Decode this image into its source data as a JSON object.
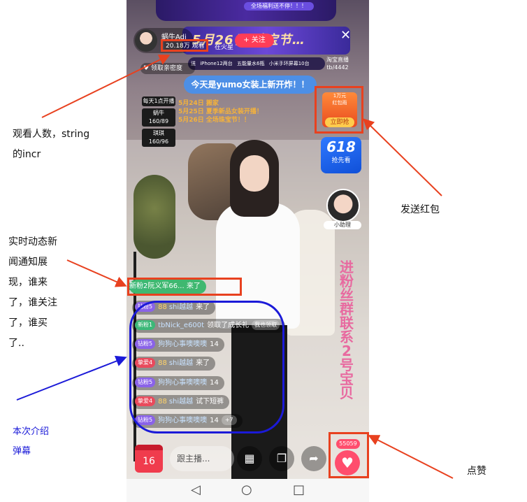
{
  "phone": {
    "top_banner_text": "全场福利送不停！！！",
    "event_banner": "5月26日 珠宝节…",
    "host_name": "蜗牛Adi",
    "viewers": "20.18万 观看",
    "region": "在火星",
    "follow_label": "+ 关注",
    "close_icon": "✕",
    "taobao_badge": "淘宝直播",
    "taobao_sub": "tb/4442",
    "intimacy_label": "领取亲密度",
    "promo_items": [
      "iPhone12两台",
      "五能量水6瓶",
      "小米手环屏幕10台"
    ],
    "promo_prefix": "送",
    "notice": "今天是yumo女装上新开炸！！",
    "schedule": {
      "title": "每天1点开播",
      "boxes": [
        {
          "name": "蜗牛",
          "size": "160/89"
        },
        {
          "name": "琪琪",
          "size": "160/96"
        }
      ],
      "lines": [
        "5月24日 搬家",
        "5月25日 夏季新品女装开播！",
        "5月26日 全场珠宝节！！"
      ]
    },
    "redpack": {
      "amount": "1万元",
      "label": "红包雨",
      "button": "立即抢"
    },
    "badge618": {
      "big": "618",
      "small": "抢先看"
    },
    "helper_label": "小助理",
    "vertical_ad": "进粉丝群联系2号宝贝",
    "messages": [
      {
        "tag": "新粉2",
        "tag_color": "green",
        "user": "阮义军66...",
        "text": "来了",
        "highlight": true
      },
      {
        "tag": "钻粉5",
        "tag_color": "purple",
        "num": "88",
        "user": "shi越越",
        "text": "来了"
      },
      {
        "tag": "新粉1",
        "tag_color": "green",
        "user": "tbNick_e600t",
        "text": "领取了成长礼",
        "extra": "我也领取"
      },
      {
        "tag": "钻粉5",
        "tag_color": "purple",
        "user": "狗狗心事噢噢噢",
        "text": "14"
      },
      {
        "tag": "挚爱4",
        "tag_color": "red",
        "num": "88",
        "user": "shi越越",
        "text": "来了"
      },
      {
        "tag": "钻粉5",
        "tag_color": "purple",
        "user": "狗狗心事噢噢噢",
        "text": "14"
      },
      {
        "tag": "挚爱4",
        "tag_color": "red",
        "num": "88",
        "user": "shi越越",
        "text": "试下短裤"
      },
      {
        "tag": "钻粉5",
        "tag_color": "purple",
        "user": "狗狗心事噢噢噢",
        "text": "14",
        "plus": "+7"
      }
    ],
    "bottom": {
      "calendar_day": "16",
      "chat_placeholder": "跟主播...",
      "like_count": "55059"
    }
  },
  "annotations": {
    "viewers_note": [
      "观看人数，string",
      "的incr"
    ],
    "redpack_note": "发送红包",
    "feed_note": [
      "实时动态新",
      "闻通知展",
      "现，谁来",
      "了，谁关注",
      "了，谁买",
      "了.."
    ],
    "danmaku_note": [
      "本次介绍",
      "弹幕"
    ],
    "like_note": "点赞"
  },
  "colors": {
    "annotation_red": "#e8411f",
    "annotation_blue": "#1b1ad8",
    "like": "#ff4d6d"
  }
}
